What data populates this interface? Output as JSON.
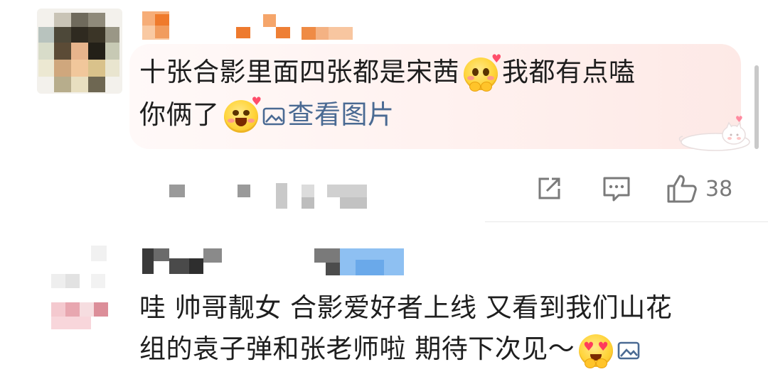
{
  "comments": [
    {
      "avatar": "pixelated-avatar",
      "username": "",
      "text_line1_a": "十张合影里面四张都是宋茜",
      "text_line1_b": "我都有点嗑",
      "text_line2_a": "你俩了",
      "view_image_label": "查看图片",
      "actions": {
        "share_icon": "share-icon",
        "reply_icon": "comment-icon",
        "like_icon": "thumbs-up-icon",
        "like_count": "38"
      },
      "emojis": [
        "blushing-face-emoji",
        "grinning-face-emoji"
      ],
      "sticker": "cat-sticker"
    },
    {
      "avatar": "pixelated-avatar",
      "username": "",
      "text_line1": "哇 帅哥靓女 合影爱好者上线 又看到我们山花",
      "text_line2": "组的袁子弹和张老师啦 期待下次见～",
      "emojis": [
        "heart-eyes-emoji"
      ],
      "image_icon": "image-icon"
    }
  ],
  "colors": {
    "link": "#4a6a93",
    "bubble": "#fff1ef",
    "text": "#1e1e1e",
    "meta": "#7a7a7a"
  }
}
